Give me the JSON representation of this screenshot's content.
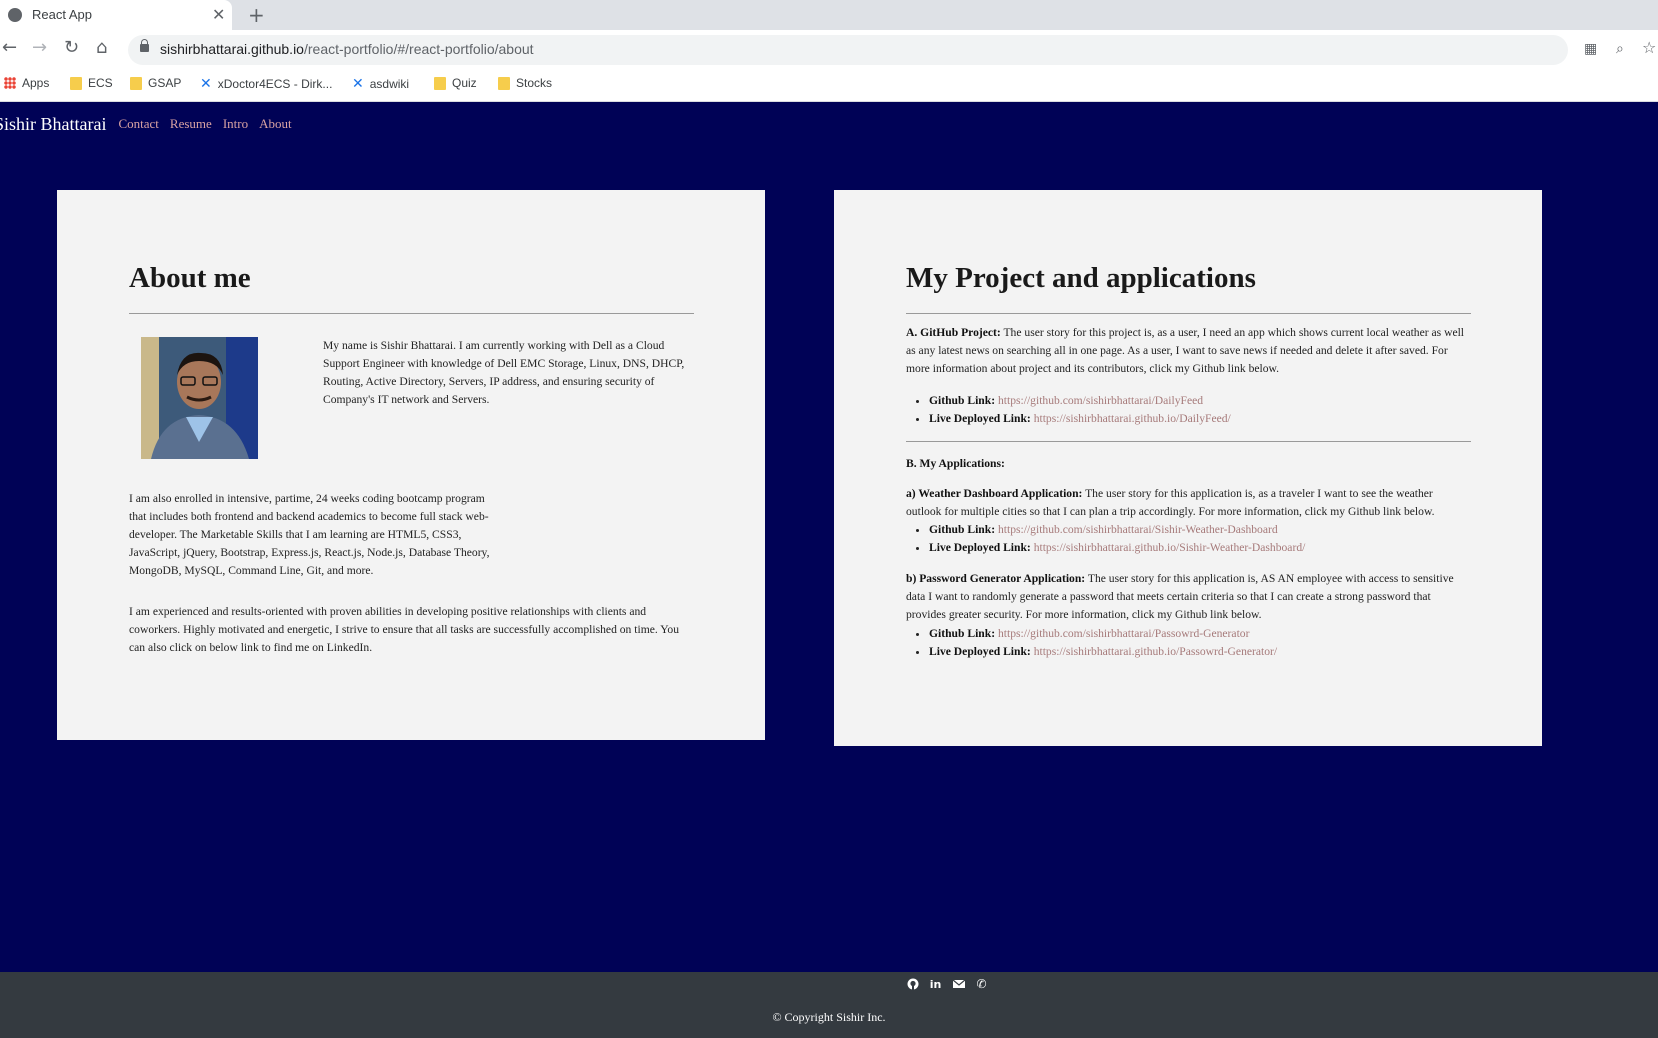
{
  "browser": {
    "tab_title": "React App",
    "url_host": "sishirbhattarai.github.io",
    "url_path": "/react-portfolio/#/react-portfolio/about",
    "bookmarks": [
      "Apps",
      "ECS",
      "GSAP",
      "xDoctor4ECS - Dirk...",
      "asdwiki",
      "Quiz",
      "Stocks"
    ]
  },
  "nav": {
    "brand": "Sishir Bhattarai",
    "links": [
      "Contact",
      "Resume",
      "Intro",
      "About"
    ]
  },
  "about": {
    "title": "About me",
    "intro": "My name is Sishir Bhattarai. I am currently working with Dell as a Cloud Support Engineer with knowledge of Dell EMC Storage, Linux, DNS, DHCP, Routing, Active Directory, Servers, IP address, and ensuring security of Company's IT network and Servers.",
    "bootcamp": "I am also enrolled in intensive, partime, 24 weeks coding bootcamp program that includes both frontend and backend academics to become full stack web-developer. The Marketable Skills that I am learning are HTML5, CSS3, JavaScript, jQuery, Bootstrap, Express.js, React.js, Node.js, Database Theory, MongoDB, MySQL, Command Line, Git, and more.",
    "experience": "I am experienced and results-oriented with proven abilities in developing positive relationships with clients and coworkers. Highly motivated and energetic, I strive to ensure that all tasks are successfully accomplished on time. You can also click on below link to find me on LinkedIn."
  },
  "projects": {
    "title": "My Project and applications",
    "github_project": {
      "label": "A. GitHub Project:",
      "text": " The user story for this project is, as a user, I need an app which shows current local weather as well as any latest news on searching all in one page. As a user, I want to save news if needed and delete it after saved. For more information about project and its contributors, click my Github link below.",
      "github_label": "Github Link:",
      "github_url": "https://github.com/sishirbhattarai/DailyFeed",
      "live_label": "Live Deployed Link:",
      "live_url": "https://sishirbhattarai.github.io/DailyFeed/"
    },
    "apps_heading": "B. My Applications:",
    "weather": {
      "label": "a) Weather Dashboard Application:",
      "text": " The user story for this application is, as a traveler I want to see the weather outlook for multiple cities so that I can plan a trip accordingly. For more information, click my Github link below.",
      "github_label": "Github Link:",
      "github_url": "https://github.com/sishirbhattarai/Sishir-Weather-Dashboard",
      "live_label": "Live Deployed Link:",
      "live_url": "https://sishirbhattarai.github.io/Sishir-Weather-Dashboard/"
    },
    "password": {
      "label": "b) Password Generator Application:",
      "text": " The user story for this application is, AS AN employee with access to sensitive data I want to randomly generate a password that meets certain criteria so that I can create a strong password that provides greater security. For more information, click my Github link below.",
      "github_label": "Github Link:",
      "github_url": "https://github.com/sishirbhattarai/Passowrd-Generator",
      "live_label": "Live Deployed Link:",
      "live_url": "https://sishirbhattarai.github.io/Passowrd-Generator/"
    }
  },
  "footer": {
    "icons": [
      "github-icon",
      "linkedin-icon",
      "envelope-icon",
      "phone-icon"
    ],
    "copyright": "© Copyright Sishir Inc."
  }
}
